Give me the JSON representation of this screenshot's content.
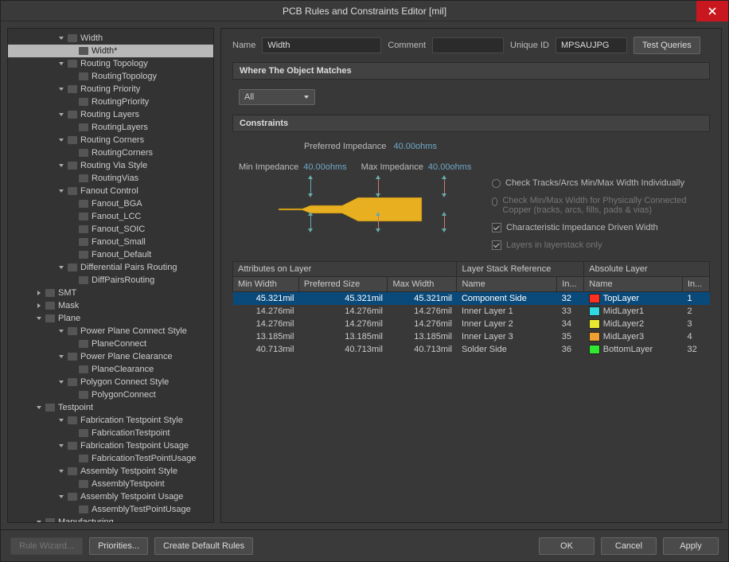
{
  "window": {
    "title": "PCB Rules and Constraints Editor [mil]"
  },
  "tree": [
    {
      "lvl": "ind-2",
      "exp": true,
      "label": "Width"
    },
    {
      "lvl": "ind-3",
      "exp": null,
      "label": "Width*",
      "selected": true
    },
    {
      "lvl": "ind-2",
      "exp": true,
      "label": "Routing Topology"
    },
    {
      "lvl": "ind-3",
      "exp": null,
      "label": "RoutingTopology"
    },
    {
      "lvl": "ind-2",
      "exp": true,
      "label": "Routing Priority"
    },
    {
      "lvl": "ind-3",
      "exp": null,
      "label": "RoutingPriority"
    },
    {
      "lvl": "ind-2",
      "exp": true,
      "label": "Routing Layers"
    },
    {
      "lvl": "ind-3",
      "exp": null,
      "label": "RoutingLayers"
    },
    {
      "lvl": "ind-2",
      "exp": true,
      "label": "Routing Corners"
    },
    {
      "lvl": "ind-3",
      "exp": null,
      "label": "RoutingCorners"
    },
    {
      "lvl": "ind-2",
      "exp": true,
      "label": "Routing Via Style"
    },
    {
      "lvl": "ind-3",
      "exp": null,
      "label": "RoutingVias"
    },
    {
      "lvl": "ind-2",
      "exp": true,
      "label": "Fanout Control"
    },
    {
      "lvl": "ind-3",
      "exp": null,
      "label": "Fanout_BGA"
    },
    {
      "lvl": "ind-3",
      "exp": null,
      "label": "Fanout_LCC"
    },
    {
      "lvl": "ind-3",
      "exp": null,
      "label": "Fanout_SOIC"
    },
    {
      "lvl": "ind-3",
      "exp": null,
      "label": "Fanout_Small"
    },
    {
      "lvl": "ind-3",
      "exp": null,
      "label": "Fanout_Default"
    },
    {
      "lvl": "ind-2",
      "exp": true,
      "label": "Differential Pairs Routing"
    },
    {
      "lvl": "ind-3",
      "exp": null,
      "label": "DiffPairsRouting"
    },
    {
      "lvl": "ind-0a",
      "exp": false,
      "label": "SMT"
    },
    {
      "lvl": "ind-0a",
      "exp": false,
      "label": "Mask"
    },
    {
      "lvl": "ind-0a",
      "exp": true,
      "label": "Plane"
    },
    {
      "lvl": "ind-2",
      "exp": true,
      "label": "Power Plane Connect Style"
    },
    {
      "lvl": "ind-3",
      "exp": null,
      "label": "PlaneConnect"
    },
    {
      "lvl": "ind-2",
      "exp": true,
      "label": "Power Plane Clearance"
    },
    {
      "lvl": "ind-3",
      "exp": null,
      "label": "PlaneClearance"
    },
    {
      "lvl": "ind-2",
      "exp": true,
      "label": "Polygon Connect Style"
    },
    {
      "lvl": "ind-3",
      "exp": null,
      "label": "PolygonConnect"
    },
    {
      "lvl": "ind-0a",
      "exp": true,
      "label": "Testpoint"
    },
    {
      "lvl": "ind-2",
      "exp": true,
      "label": "Fabrication Testpoint Style"
    },
    {
      "lvl": "ind-3",
      "exp": null,
      "label": "FabricationTestpoint"
    },
    {
      "lvl": "ind-2",
      "exp": true,
      "label": "Fabrication Testpoint Usage"
    },
    {
      "lvl": "ind-3",
      "exp": null,
      "label": "FabricationTestPointUsage"
    },
    {
      "lvl": "ind-2",
      "exp": true,
      "label": "Assembly Testpoint Style"
    },
    {
      "lvl": "ind-3",
      "exp": null,
      "label": "AssemblyTestpoint"
    },
    {
      "lvl": "ind-2",
      "exp": true,
      "label": "Assembly Testpoint Usage"
    },
    {
      "lvl": "ind-3",
      "exp": null,
      "label": "AssemblyTestPointUsage"
    },
    {
      "lvl": "ind-0a",
      "exp": true,
      "label": "Manufacturing"
    }
  ],
  "form": {
    "name_label": "Name",
    "name_value": "Width",
    "comment_label": "Comment",
    "comment_value": "",
    "uniqueid_label": "Unique ID",
    "uniqueid_value": "MPSAUJPG",
    "test_queries": "Test Queries"
  },
  "sections": {
    "where": "Where The Object Matches",
    "constraints": "Constraints"
  },
  "scope": {
    "value": "All"
  },
  "impedance": {
    "pref_label": "Preferred Impedance",
    "pref_value": "40.00ohms",
    "min_label": "Min Impedance",
    "min_value": "40.00ohms",
    "max_label": "Max Impedance",
    "max_value": "40.00ohms"
  },
  "options": {
    "radio1": "Check Tracks/Arcs Min/Max Width Individually",
    "radio2": "Check Min/Max Width for Physically Connected Copper (tracks, arcs, fills, pads & vias)",
    "check1": "Characteristic Impedance Driven Width",
    "check2": "Layers in layerstack only"
  },
  "table": {
    "group1": "Attributes on Layer",
    "group2": "Layer Stack Reference",
    "group3": "Absolute Layer",
    "cols": {
      "minw": "Min Width",
      "pref": "Preferred Size",
      "maxw": "Max Width",
      "name1": "Name",
      "idx1": "In...",
      "name2": "Name",
      "idx2": "In..."
    },
    "rows": [
      {
        "minw": "45.321mil",
        "pref": "45.321mil",
        "maxw": "45.321mil",
        "name1": "Component Side",
        "idx1": "32",
        "color": "#ff3020",
        "name2": "TopLayer",
        "idx2": "1",
        "sel": true
      },
      {
        "minw": "14.276mil",
        "pref": "14.276mil",
        "maxw": "14.276mil",
        "name1": "Inner Layer 1",
        "idx1": "33",
        "color": "#30d8e0",
        "name2": "MidLayer1",
        "idx2": "2"
      },
      {
        "minw": "14.276mil",
        "pref": "14.276mil",
        "maxw": "14.276mil",
        "name1": "Inner Layer 2",
        "idx1": "34",
        "color": "#e8e830",
        "name2": "MidLayer2",
        "idx2": "3"
      },
      {
        "minw": "13.185mil",
        "pref": "13.185mil",
        "maxw": "13.185mil",
        "name1": "Inner Layer 3",
        "idx1": "35",
        "color": "#f0a030",
        "name2": "MidLayer3",
        "idx2": "4"
      },
      {
        "minw": "40.713mil",
        "pref": "40.713mil",
        "maxw": "40.713mil",
        "name1": "Solder Side",
        "idx1": "36",
        "color": "#30e830",
        "name2": "BottomLayer",
        "idx2": "32"
      }
    ]
  },
  "footer": {
    "rule_wizard": "Rule Wizard...",
    "priorities": "Priorities...",
    "create_default": "Create Default Rules",
    "ok": "OK",
    "cancel": "Cancel",
    "apply": "Apply"
  }
}
